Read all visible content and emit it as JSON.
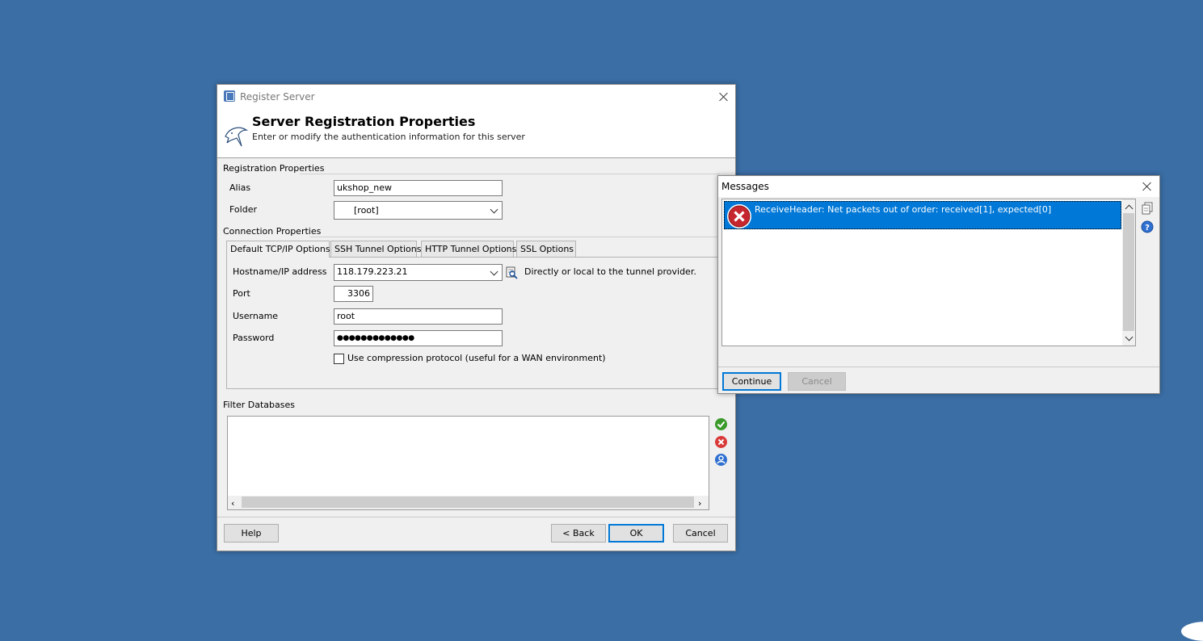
{
  "register_dialog": {
    "title": "Register Server",
    "header_title": "Server Registration Properties",
    "header_subtitle": "Enter or modify the authentication information for this server",
    "registration_section": "Registration Properties",
    "alias_label": "Alias",
    "alias_value": "ukshop_new",
    "folder_label": "Folder",
    "folder_value": "[root]",
    "connection_section": "Connection Properties",
    "tabs": [
      {
        "label": "Default TCP/IP Options",
        "active": true
      },
      {
        "label": "SSH Tunnel Options",
        "active": false
      },
      {
        "label": "HTTP Tunnel Options",
        "active": false
      },
      {
        "label": "SSL Options",
        "active": false
      }
    ],
    "hostname_label": "Hostname/IP address",
    "hostname_value": "118.179.223.21",
    "hostname_hint": "Directly or local to the tunnel provider.",
    "port_label": "Port",
    "port_value": "3306",
    "username_label": "Username",
    "username_value": "root",
    "password_label": "Password",
    "password_value": "●●●●●●●●●●●●●",
    "compression_label": "Use compression protocol (useful for a WAN environment)",
    "compression_checked": false,
    "filter_section": "Filter Databases",
    "buttons": {
      "help": "Help",
      "back": "< Back",
      "ok": "OK",
      "cancel": "Cancel"
    },
    "side_icons": [
      "check-icon",
      "remove-icon",
      "user-icon"
    ]
  },
  "messages_dialog": {
    "title": "Messages",
    "message_text": "ReceiveHeader: Net packets out of order: received[1], expected[0]",
    "message_icon": "error-icon",
    "selection_color": "#0078d7",
    "buttons": {
      "continue": "Continue",
      "cancel": "Cancel"
    },
    "side_icons": [
      "copy-icon",
      "help-icon"
    ]
  }
}
